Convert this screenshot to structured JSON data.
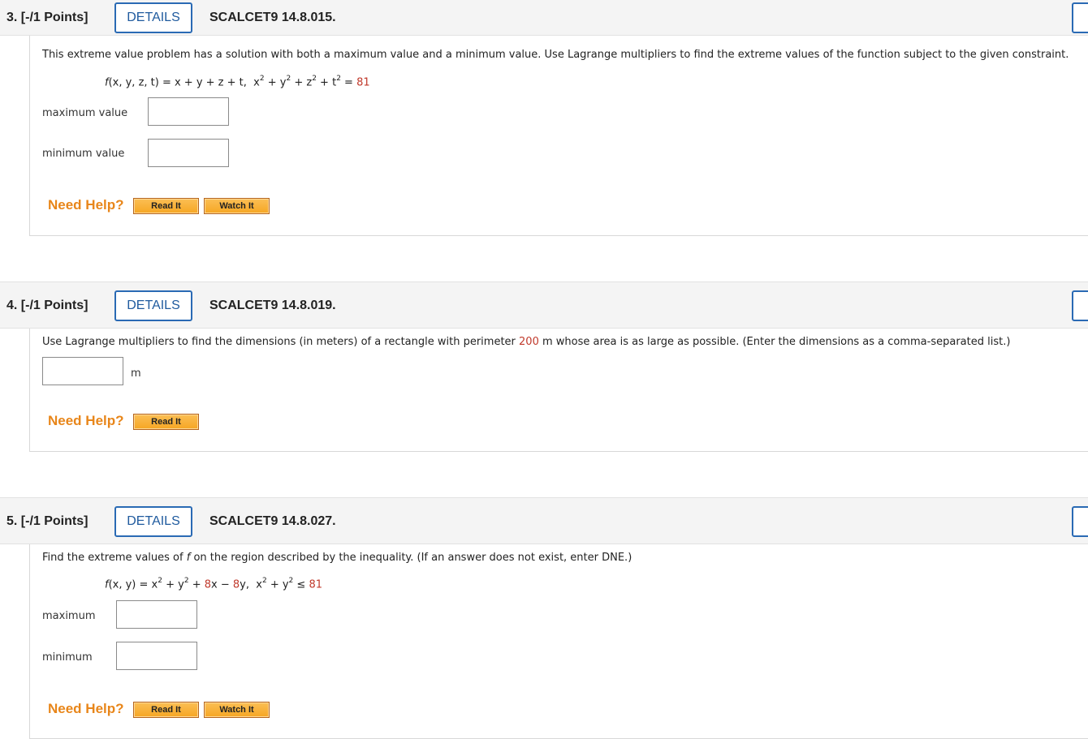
{
  "q3": {
    "number": "3.  [-/1 Points]",
    "details": "DETAILS",
    "code": "SCALCET9 14.8.015.",
    "prompt": "This extreme value problem has a solution with both a maximum value and a minimum value. Use Lagrange multipliers to find the extreme values of the function subject to the given constraint.",
    "eq_fn": "f",
    "eq_args": "(x, y, z, t) = x + y + z + t,",
    "eq_const": "81",
    "max_label": "maximum value",
    "min_label": "minimum value",
    "max_value": "",
    "min_value": "",
    "need_help": "Need Help?",
    "read_it": "Read It",
    "watch_it": "Watch It"
  },
  "q4": {
    "number": "4.  [-/1 Points]",
    "details": "DETAILS",
    "code": "SCALCET9 14.8.019.",
    "prompt_a": "Use Lagrange multipliers to find the dimensions (in meters) of a rectangle with perimeter ",
    "perimeter": "200",
    "prompt_b": " m whose area is as large as possible. (Enter the dimensions as a comma-separated list.)",
    "unit": "m",
    "answer_value": "",
    "need_help": "Need Help?",
    "read_it": "Read It"
  },
  "q5": {
    "number": "5.  [-/1 Points]",
    "details": "DETAILS",
    "code": "SCALCET9 14.8.027.",
    "prompt_a": "Find the extreme values of ",
    "prompt_f": "f",
    "prompt_b": " on the region described by the inequality. (If an answer does not exist, enter DNE.)",
    "eq_fn": "f",
    "eq_args": "(x, y) = x",
    "eq_coef1": "8",
    "eq_coef2": "8",
    "eq_const": "81",
    "max_label": "maximum",
    "min_label": "minimum",
    "max_value": "",
    "min_value": "",
    "need_help": "Need Help?",
    "read_it": "Read It",
    "watch_it": "Watch It"
  },
  "colors": {
    "accent_blue": "#2a6ab4",
    "help_orange": "#e8861a",
    "number_red": "#c0392b"
  }
}
